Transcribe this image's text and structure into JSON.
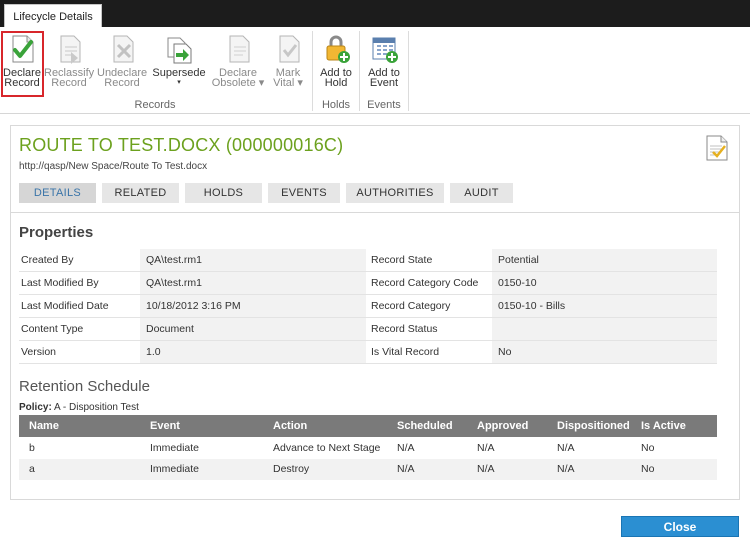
{
  "window": {
    "tab_label": "Lifecycle Details"
  },
  "ribbon": {
    "buttons": [
      {
        "l1": "Declare",
        "l2": "Record",
        "enabled": true,
        "highlighted": true
      },
      {
        "l1": "Reclassify",
        "l2": "Record",
        "enabled": false
      },
      {
        "l1": "Undeclare",
        "l2": "Record",
        "enabled": false
      },
      {
        "l1": "Supersede",
        "l2": "▾",
        "enabled": true
      },
      {
        "l1": "Declare",
        "l2": "Obsolete ▾",
        "enabled": false
      },
      {
        "l1": "Mark",
        "l2": "Vital ▾",
        "enabled": false
      },
      {
        "l1": "Add to",
        "l2": "Hold",
        "enabled": true
      },
      {
        "l1": "Add to",
        "l2": "Event",
        "enabled": true
      }
    ],
    "groups": [
      "Records",
      "Holds",
      "Events"
    ],
    "highlight_color": "#d8262b"
  },
  "record": {
    "title": "ROUTE TO TEST.DOCX (000000016C)",
    "path": "http://qasp/New Space/Route To Test.docx",
    "title_color": "#6ca11e"
  },
  "tabs": [
    "DETAILS",
    "RELATED",
    "HOLDS",
    "EVENTS",
    "AUTHORITIES",
    "AUDIT"
  ],
  "properties": {
    "heading": "Properties",
    "rows": [
      {
        "l1": "Created By",
        "v1": "QA\\test.rm1",
        "l2": "Record State",
        "v2": "Potential"
      },
      {
        "l1": "Last Modified By",
        "v1": "QA\\test.rm1",
        "l2": "Record Category Code",
        "v2": "0150-10"
      },
      {
        "l1": "Last Modified Date",
        "v1": "10/18/2012 3:16 PM",
        "l2": "Record Category",
        "v2": "0150-10 - Bills"
      },
      {
        "l1": "Content Type",
        "v1": "Document",
        "l2": "Record Status",
        "v2": ""
      },
      {
        "l1": "Version",
        "v1": "1.0",
        "l2": "Is Vital Record",
        "v2": "No"
      }
    ]
  },
  "retention": {
    "heading": "Retention Schedule",
    "policy_label": "Policy:",
    "policy_value": "A - Disposition Test",
    "columns": [
      "Name",
      "Event",
      "Action",
      "Scheduled",
      "Approved",
      "Dispositioned",
      "Is Active"
    ],
    "rows": [
      [
        "b",
        "Immediate",
        "Advance to Next Stage",
        "N/A",
        "N/A",
        "N/A",
        "No"
      ],
      [
        "a",
        "Immediate",
        "Destroy",
        "N/A",
        "N/A",
        "N/A",
        "No"
      ]
    ]
  },
  "footer": {
    "close_label": "Close",
    "accent": "#2b8fd2"
  },
  "icons": [
    "declare-record-icon",
    "reclassify-record-icon",
    "undeclare-record-icon",
    "supersede-icon",
    "declare-obsolete-icon",
    "mark-vital-icon",
    "add-to-hold-icon",
    "add-to-event-icon",
    "document-check-icon"
  ]
}
